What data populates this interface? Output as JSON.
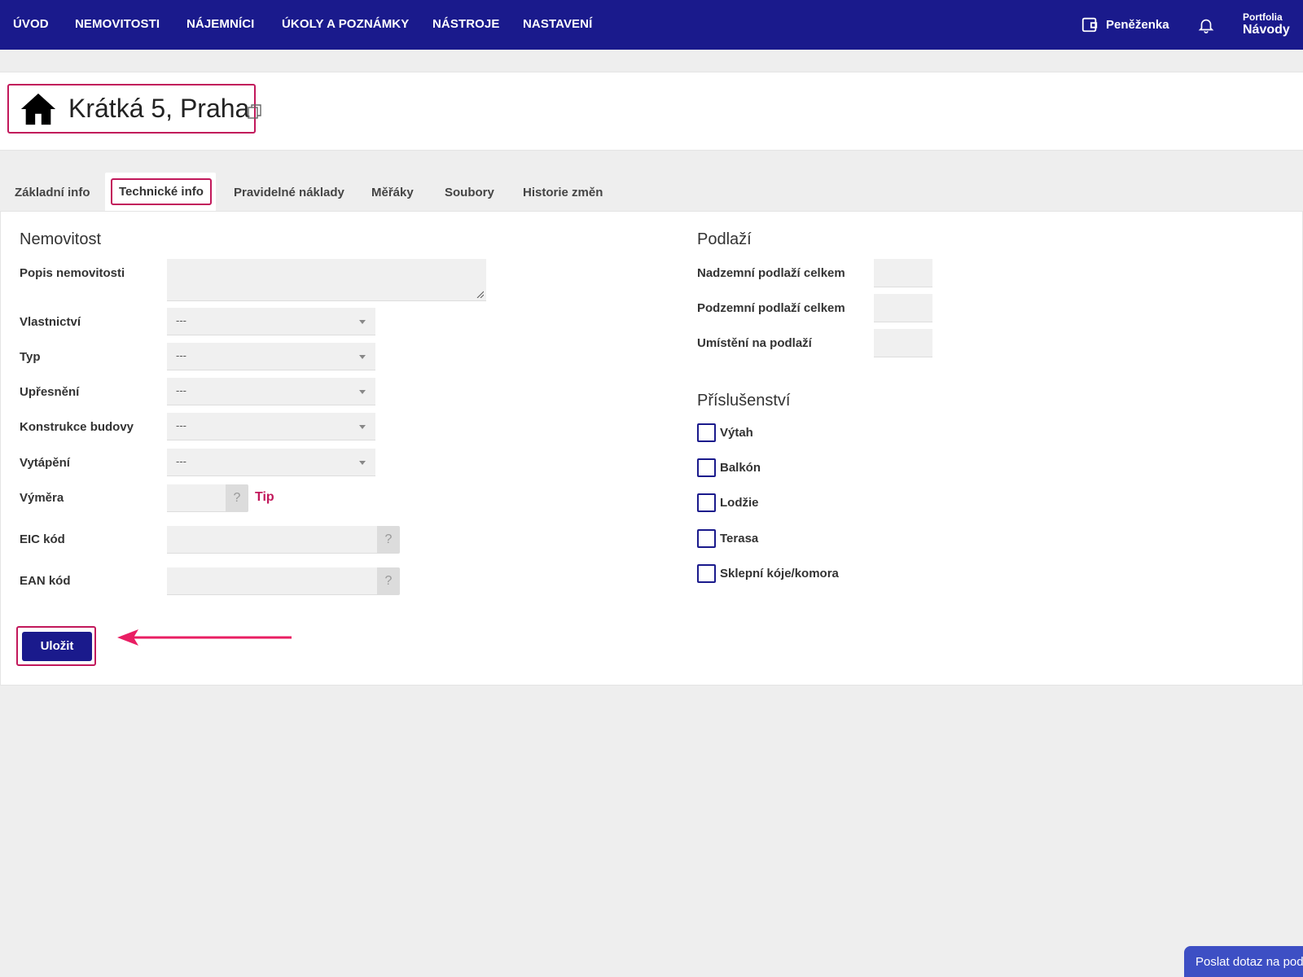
{
  "nav": {
    "items": [
      "ÚVOD",
      "NEMOVITOSTI",
      "NÁJEMNÍCI",
      "ÚKOLY A POZNÁMKY",
      "NÁSTROJE",
      "NASTAVENÍ"
    ],
    "wallet_label": "Peněženka",
    "portfolio_label": "Portfolia",
    "portfolio_value": "Návody"
  },
  "property": {
    "title": "Krátká 5, Praha"
  },
  "tabs": [
    {
      "label": "Základní info"
    },
    {
      "label": "Technické info",
      "active": true
    },
    {
      "label": "Pravidelné náklady"
    },
    {
      "label": "Měřáky"
    },
    {
      "label": "Soubory"
    },
    {
      "label": "Historie změn"
    }
  ],
  "form": {
    "left_section_title": "Nemovitost",
    "description_label": "Popis nemovitosti",
    "description_value": "",
    "selects": [
      {
        "label": "Vlastnictví",
        "value": "---"
      },
      {
        "label": "Typ",
        "value": "---"
      },
      {
        "label": "Upřesnění",
        "value": "---"
      },
      {
        "label": "Konstrukce budovy",
        "value": "---"
      },
      {
        "label": "Vytápění",
        "value": "---"
      }
    ],
    "area_label": "Výměra",
    "area_help": "?",
    "tip_label": "Tip",
    "eic_label": "EIC kód",
    "eic_help": "?",
    "ean_label": "EAN kód",
    "ean_help": "?",
    "right_section_title": "Podlaží",
    "floors": [
      {
        "label": "Nadzemní podlaží celkem",
        "value": ""
      },
      {
        "label": "Podzemní podlaží celkem",
        "value": ""
      },
      {
        "label": "Umístění na podlaží",
        "value": ""
      }
    ],
    "accessories_title": "Příslušenství",
    "accessories": [
      {
        "label": "Výtah",
        "checked": false
      },
      {
        "label": "Balkón",
        "checked": false
      },
      {
        "label": "Lodžie",
        "checked": false
      },
      {
        "label": "Terasa",
        "checked": false
      },
      {
        "label": "Sklepní kóje/komora",
        "checked": false
      }
    ],
    "save_label": "Uložit"
  },
  "help_button_label": "Poslat dotaz na podporu",
  "colors": {
    "nav_bg": "#1a1a8c",
    "highlight": "#c2185b",
    "primary_button": "#1a1a8c",
    "help_button": "#3d4fc4"
  }
}
